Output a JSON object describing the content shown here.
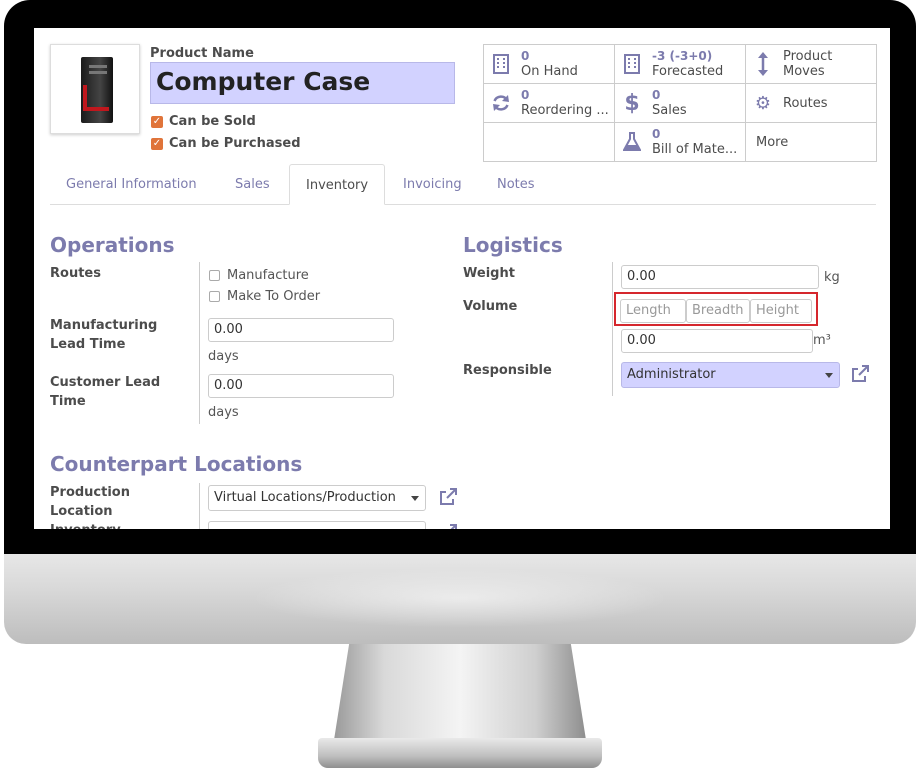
{
  "product": {
    "name_label": "Product Name",
    "name": "Computer Case",
    "can_be_sold": "Can be Sold",
    "can_be_purchased": "Can be Purchased"
  },
  "stats": [
    {
      "icon": "building-icon",
      "value": "0",
      "label": "On Hand"
    },
    {
      "icon": "building-icon",
      "value": "-3 (-3+0)",
      "label": "Forecasted"
    },
    {
      "icon": "updown-arrow-icon",
      "value": "",
      "label": "Product",
      "label2": "Moves"
    },
    {
      "icon": "refresh-icon",
      "value": "0",
      "label": "Reordering ..."
    },
    {
      "icon": "dollar-icon",
      "value": "0",
      "label": "Sales"
    },
    {
      "icon": "gears-icon",
      "value": "",
      "label": "Routes"
    },
    {
      "icon": "",
      "value": "",
      "label": ""
    },
    {
      "icon": "flask-icon",
      "value": "0",
      "label": "Bill of Mate..."
    },
    {
      "icon": "",
      "value": "",
      "label": "More"
    }
  ],
  "tabs": [
    "General Information",
    "Sales",
    "Inventory",
    "Invoicing",
    "Notes"
  ],
  "operations": {
    "title": "Operations",
    "routes_label": "Routes",
    "route_manufacture": "Manufacture",
    "route_mto": "Make To Order",
    "mfg_lead_label_1": "Manufacturing",
    "mfg_lead_label_2": "Lead Time",
    "mfg_lead_value": "0.00",
    "mfg_lead_unit": "days",
    "cust_lead_label_1": "Customer Lead",
    "cust_lead_label_2": "Time",
    "cust_lead_value": "0.00",
    "cust_lead_unit": "days"
  },
  "logistics": {
    "title": "Logistics",
    "weight_label": "Weight",
    "weight_value": "0.00",
    "weight_unit": "kg",
    "volume_label": "Volume",
    "length_placeholder": "Length",
    "breadth_placeholder": "Breadth",
    "height_placeholder": "Height",
    "volume_value": "0.00",
    "volume_unit": "m³",
    "responsible_label": "Responsible",
    "responsible_value": "Administrator"
  },
  "counterpart": {
    "title": "Counterpart Locations",
    "production_label_1": "Production",
    "production_label_2": "Location",
    "production_value": "Virtual Locations/Production",
    "inventory_label": "Inventory"
  },
  "colors": {
    "accent": "#7c7bad",
    "highlight": "#d2d2ff",
    "checkbox": "#e0743a",
    "callout": "#d5272d"
  }
}
